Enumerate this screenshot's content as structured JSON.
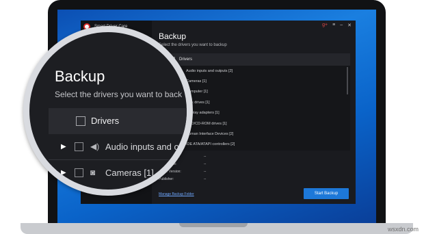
{
  "app": {
    "name": "Smart Driver Care",
    "window_controls": [
      "g+",
      "menu",
      "minimize",
      "close"
    ]
  },
  "backup": {
    "title": "Backup",
    "subtitle": "Select the drivers you want to backup",
    "list_header": "Drivers",
    "items": [
      {
        "label": "Audio inputs and outputs [2]",
        "icon": "speaker-icon"
      },
      {
        "label": "Cameras [1]",
        "icon": "camera-icon"
      },
      {
        "label": "Computer [1]",
        "icon": "monitor-icon"
      },
      {
        "label": "Disk drives [1]",
        "icon": "disk-icon"
      },
      {
        "label": "Display adapters [1]",
        "icon": "display-icon"
      },
      {
        "label": "DVD/CD-ROM drives [1]",
        "icon": "disc-icon"
      },
      {
        "label": "Human Interface Devices [2]",
        "icon": "hid-icon"
      },
      {
        "label": "IDE ATA/ATAPI controllers [2]",
        "icon": "controller-icon"
      }
    ],
    "info": [
      {
        "key": "Device Name:",
        "value": "--"
      },
      {
        "key": "Driver Date:",
        "value": "--"
      },
      {
        "key": "Driver Version:",
        "value": "--"
      },
      {
        "key": "Publisher:",
        "value": "--"
      }
    ],
    "manage_link": "Manage Backup Folder",
    "start_button": "Start Backup"
  },
  "magnified": {
    "title": "Backup",
    "subtitle": "Select the drivers you want to back",
    "header": "Drivers",
    "rows": [
      {
        "label": "Audio inputs and o"
      },
      {
        "label": "Cameras [1]"
      }
    ]
  },
  "watermark": "wsxdn.com",
  "colors": {
    "accent": "#1d78d8",
    "window_bg": "#1a1b1f",
    "desktop_blue": "#0a63c9"
  }
}
